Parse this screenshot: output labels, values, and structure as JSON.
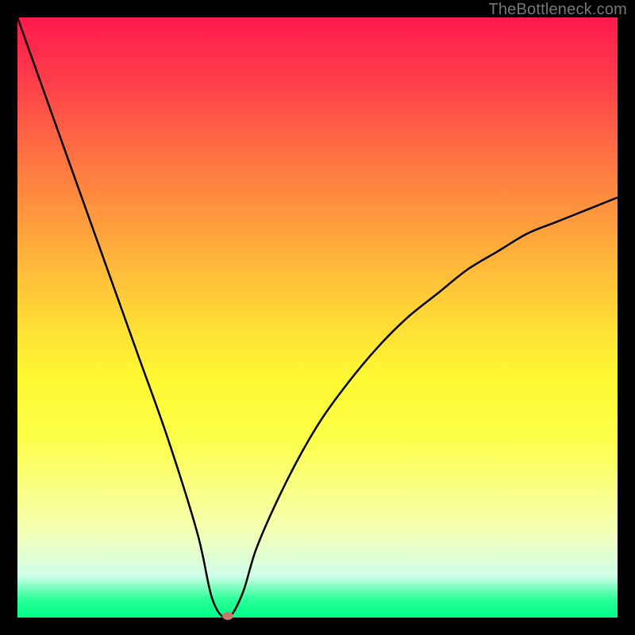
{
  "watermark": "TheBottleneck.com",
  "chart_data": {
    "type": "line",
    "title": "",
    "xlabel": "",
    "ylabel": "",
    "x_range_fraction": [
      0,
      1
    ],
    "y_range_percent": [
      0,
      100
    ],
    "series": [
      {
        "name": "bottleneck-curve",
        "x": [
          0.0,
          0.05,
          0.1,
          0.15,
          0.2,
          0.25,
          0.3,
          0.325,
          0.35,
          0.375,
          0.4,
          0.45,
          0.5,
          0.55,
          0.6,
          0.65,
          0.7,
          0.75,
          0.8,
          0.85,
          0.9,
          0.95,
          1.0
        ],
        "y": [
          100,
          86,
          72,
          58,
          44,
          30,
          14,
          3,
          0,
          4,
          12,
          23,
          32,
          39,
          45,
          50,
          54,
          58,
          61,
          64,
          66,
          68,
          70
        ]
      }
    ],
    "marker": {
      "x_fraction": 0.35,
      "y_percent": 0
    },
    "gradient_note": "green (0%) at bottom through yellow (~50%) to red (100%) at top"
  }
}
